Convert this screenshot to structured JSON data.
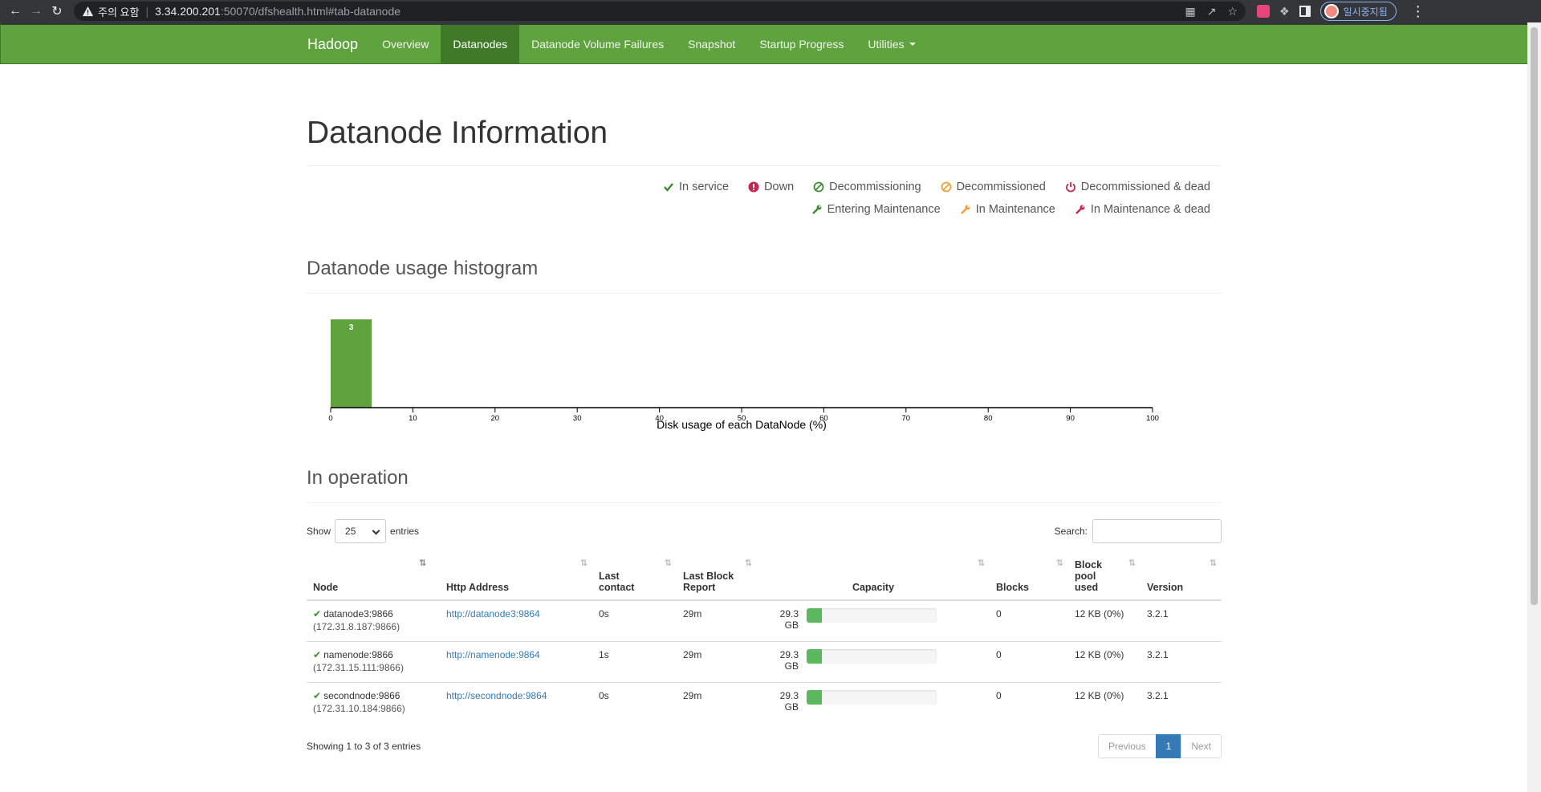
{
  "browser": {
    "warning_label": "주의 요함",
    "url_host": "3.34.200.201",
    "url_path": ":50070/dfshealth.html#tab-datanode",
    "profile_label": "일시중지됨"
  },
  "navbar": {
    "brand": "Hadoop",
    "links": [
      "Overview",
      "Datanodes",
      "Datanode Volume Failures",
      "Snapshot",
      "Startup Progress",
      "Utilities"
    ]
  },
  "page_title": "Datanode Information",
  "legend": {
    "row1": [
      "In service",
      "Down",
      "Decommissioning",
      "Decommissioned",
      "Decommissioned & dead"
    ],
    "row2": [
      "Entering Maintenance",
      "In Maintenance",
      "In Maintenance & dead"
    ],
    "colors": {
      "green": "#3c8d2f",
      "red": "#c7254e",
      "orange": "#f0a030"
    }
  },
  "histogram_title": "Datanode usage histogram",
  "chart_data": {
    "type": "bar",
    "xlabel": "Disk usage of each DataNode (%)",
    "xlim": [
      0,
      100
    ],
    "xticks": [
      "0",
      "10",
      "20",
      "30",
      "40",
      "50",
      "60",
      "70",
      "80",
      "90",
      "100"
    ],
    "bins": [
      {
        "from": 0,
        "to": 5,
        "count": 3
      }
    ],
    "bar_label": "3",
    "bar_color": "#5fa33e"
  },
  "operation_title": "In operation",
  "table_controls": {
    "show_label": "Show",
    "entries_value": "25",
    "entries_label": "entries",
    "search_label": "Search:"
  },
  "table": {
    "headers": {
      "node": "Node",
      "http": "Http Address",
      "last_contact_1": "Last",
      "last_contact_2": "contact",
      "last_block_1": "Last Block",
      "last_block_2": "Report",
      "capacity": "Capacity",
      "blocks": "Blocks",
      "pool_1": "Block",
      "pool_2": "pool",
      "pool_3": "used",
      "version": "Version"
    },
    "rows": [
      {
        "node": "datanode3:9866",
        "ip": "(172.31.8.187:9866)",
        "http": "http://datanode3:9864",
        "contact": "0s",
        "report": "29m",
        "capacity": "29.3 GB",
        "used_fraction": 0.12,
        "blocks": "0",
        "pool": "12 KB (0%)",
        "version": "3.2.1"
      },
      {
        "node": "namenode:9866",
        "ip": "(172.31.15.111:9866)",
        "http": "http://namenode:9864",
        "contact": "1s",
        "report": "29m",
        "capacity": "29.3 GB",
        "used_fraction": 0.12,
        "blocks": "0",
        "pool": "12 KB (0%)",
        "version": "3.2.1"
      },
      {
        "node": "secondnode:9866",
        "ip": "(172.31.10.184:9866)",
        "http": "http://secondnode:9864",
        "contact": "0s",
        "report": "29m",
        "capacity": "29.3 GB",
        "used_fraction": 0.12,
        "blocks": "0",
        "pool": "12 KB (0%)",
        "version": "3.2.1"
      }
    ]
  },
  "footer": {
    "info": "Showing 1 to 3 of 3 entries",
    "prev": "Previous",
    "page": "1",
    "next": "Next"
  }
}
